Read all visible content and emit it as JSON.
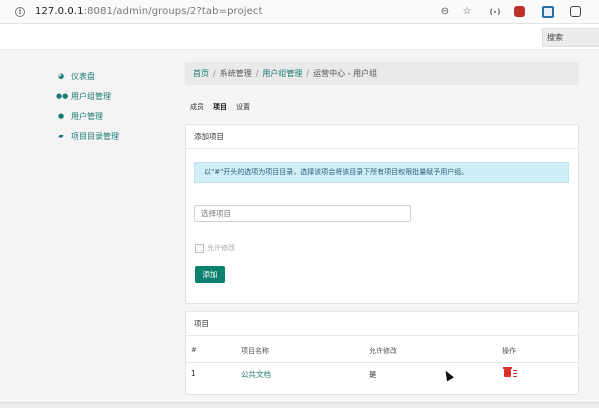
{
  "browser": {
    "url_host": "127.0.0.1",
    "url_rest": ":8081/admin/groups/2?tab=project",
    "ext_label": "(∘)"
  },
  "topbar": {
    "search_label": "搜索"
  },
  "sidebar": {
    "items": [
      {
        "label": "仪表盘",
        "icon": "dashboard-icon"
      },
      {
        "label": "用户组管理",
        "icon": "users-icon"
      },
      {
        "label": "用户管理",
        "icon": "user-icon"
      },
      {
        "label": "项目目录管理",
        "icon": "folder-open-icon"
      }
    ]
  },
  "breadcrumb": {
    "items": [
      "首页",
      "系统管理",
      "用户组管理",
      "运营中心 - 用户组"
    ],
    "sep": "/"
  },
  "tabs": [
    {
      "label": "成员",
      "active": false
    },
    {
      "label": "项目",
      "active": true
    },
    {
      "label": "设置",
      "active": false
    }
  ],
  "add_card": {
    "title": "添加项目",
    "alert": "以\"#\"开头的选项为项目目录，选择该项会将该目录下所有项目权限批量赋予用户组。",
    "select_placeholder": "选择项目",
    "checkbox_label": "允许修改",
    "add_button": "添加"
  },
  "list_card": {
    "title": "项目",
    "columns": [
      "#",
      "项目名称",
      "允许修改",
      "操作"
    ],
    "rows": [
      {
        "num": "1",
        "name": "公共文档",
        "allow": "是"
      }
    ]
  },
  "colors": {
    "accent": "#1a7a73",
    "button": "#0e8070",
    "alert_bg": "#cfeef8",
    "danger": "#d9302b"
  }
}
